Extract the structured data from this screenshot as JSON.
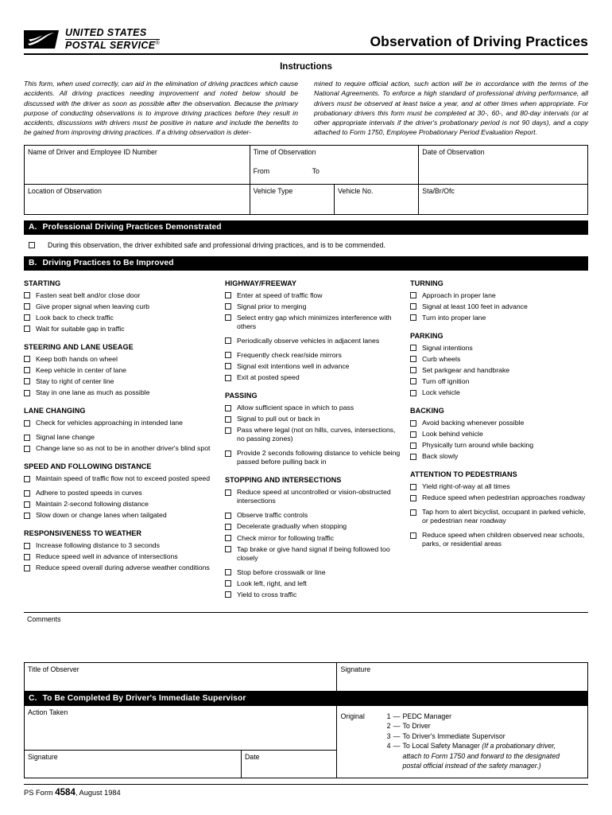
{
  "header": {
    "logo_line1": "UNITED STATES",
    "logo_line2": "POSTAL SERVICE",
    "logo_mark": "registered-mark",
    "title": "Observation of Driving Practices"
  },
  "instructions": {
    "heading": "Instructions",
    "paragraph_left": "This form, when used correctly, can aid in the elimination of driving practices which cause accidents. All driving practices needing improvement and noted below should be discussed with the driver as soon as possible after the observation. Because the primary purpose of conducting observations is to improve driving practices before they result in accidents, discussions with drivers must be positive in nature and include the benefits to be gained from improving driving practices. If a driving observation is deter-",
    "paragraph_right": "mined to require official action, such action will be in accordance with the terms of the National Agreements. To enforce a high standard of professional driving performance, all drivers must be observed at least twice a year, and at other times when appropriate. For probationary drivers this form must be completed at 30-, 60-, and 80-day intervals (or at other appropriate intervals if the driver's probationary period is not 90 days), and a copy attached to Form 1750, Employee Probationary Period Evaluation Report."
  },
  "fields": {
    "name_of_driver": "Name of Driver and Employee ID Number",
    "time_of_observation": "Time of Observation",
    "from": "From",
    "to": "To",
    "date_of_observation": "Date of Observation",
    "location_of_observation": "Location of Observation",
    "vehicle_type": "Vehicle Type",
    "vehicle_no": "Vehicle No.",
    "sta_br_ofc": "Sta/Br/Ofc"
  },
  "section_a": {
    "letter": "A.",
    "title": "Professional Driving Practices Demonstrated",
    "checkbox_label": "During this observation, the driver exhibited safe and professional driving practices, and is to be commended."
  },
  "section_b": {
    "letter": "B.",
    "title": "Driving Practices to Be Improved",
    "columns": [
      {
        "groups": [
          {
            "title": "STARTING",
            "items": [
              {
                "text": "Fasten seat belt and/or close door",
                "gap": false
              },
              {
                "text": "Give proper signal when leaving curb",
                "gap": false
              },
              {
                "text": "Look back to check traffic",
                "gap": false
              },
              {
                "text": "Wait for suitable gap in traffic",
                "gap": false
              }
            ]
          },
          {
            "title": "STEERING AND LANE USEAGE",
            "items": [
              {
                "text": "Keep both hands on wheel",
                "gap": false
              },
              {
                "text": "Keep vehicle in center of lane",
                "gap": false
              },
              {
                "text": "Stay to right of center line",
                "gap": false
              },
              {
                "text": "Stay in one lane as much as possible",
                "gap": false
              }
            ]
          },
          {
            "title": "LANE CHANGING",
            "items": [
              {
                "text": "Check for vehicles approaching in intended lane",
                "gap": false
              },
              {
                "text": "Signal lane change",
                "gap": true
              },
              {
                "text": "Change lane so as not to be in another driver's blind spot",
                "gap": false
              }
            ]
          },
          {
            "title": "SPEED AND FOLLOWING DISTANCE",
            "items": [
              {
                "text": "Maintain speed of traffic flow not to exceed posted speed",
                "gap": false
              },
              {
                "text": "Adhere to posted speeds in curves",
                "gap": true
              },
              {
                "text": "Maintain 2-second following distance",
                "gap": false
              },
              {
                "text": "Slow down or change lanes when tailgated",
                "gap": false
              }
            ]
          },
          {
            "title": "RESPONSIVENESS TO WEATHER",
            "items": [
              {
                "text": "Increase following distance to 3 seconds",
                "gap": false
              },
              {
                "text": "Reduce speed well in advance of intersections",
                "gap": false
              },
              {
                "text": "Reduce speed overall during adverse weather conditions",
                "gap": false
              }
            ]
          }
        ]
      },
      {
        "groups": [
          {
            "title": "HIGHWAY/FREEWAY",
            "items": [
              {
                "text": "Enter at speed of traffic flow",
                "gap": false
              },
              {
                "text": "Signal prior to merging",
                "gap": false
              },
              {
                "text": "Select entry gap which minimizes interference with others",
                "gap": false
              },
              {
                "text": "Periodically observe vehicles in adjacent lanes",
                "gap": true
              },
              {
                "text": "Frequently check rear/side mirrors",
                "gap": true
              },
              {
                "text": "Signal exit intentions well in advance",
                "gap": false
              },
              {
                "text": "Exit at posted speed",
                "gap": false
              }
            ]
          },
          {
            "title": "PASSING",
            "items": [
              {
                "text": "Allow sufficient space in which to pass",
                "gap": false
              },
              {
                "text": "Signal to pull out or back in",
                "gap": false
              },
              {
                "text": "Pass where legal (not on hills, curves, intersections, no passing zones)",
                "gap": false
              },
              {
                "text": "Provide 2 seconds following distance to vehicle being passed before pulling back in",
                "gap": true
              }
            ]
          },
          {
            "title": "STOPPING AND INTERSECTIONS",
            "items": [
              {
                "text": "Reduce speed at uncontrolled or vision-obstructed intersections",
                "gap": false
              },
              {
                "text": "Observe traffic controls",
                "gap": true
              },
              {
                "text": "Decelerate gradually when stopping",
                "gap": false
              },
              {
                "text": "Check mirror for following traffic",
                "gap": false
              },
              {
                "text": "Tap brake or give hand signal if being followed too closely",
                "gap": false
              },
              {
                "text": "Stop before crosswalk or line",
                "gap": true
              },
              {
                "text": "Look left, right, and left",
                "gap": false
              },
              {
                "text": "Yield to cross traffic",
                "gap": false
              }
            ]
          }
        ]
      },
      {
        "groups": [
          {
            "title": "TURNING",
            "items": [
              {
                "text": "Approach in proper lane",
                "gap": false
              },
              {
                "text": "Signal at least 100 feet in advance",
                "gap": false
              },
              {
                "text": "Turn into proper lane",
                "gap": false
              }
            ]
          },
          {
            "title": "PARKING",
            "items": [
              {
                "text": "Signal intentions",
                "gap": false
              },
              {
                "text": "Curb wheels",
                "gap": false
              },
              {
                "text": "Set parkgear and handbrake",
                "gap": false
              },
              {
                "text": "Turn off ignition",
                "gap": false
              },
              {
                "text": "Lock vehicle",
                "gap": false
              }
            ]
          },
          {
            "title": "BACKING",
            "items": [
              {
                "text": "Avoid backing whenever possible",
                "gap": false
              },
              {
                "text": "Look behind vehicle",
                "gap": false
              },
              {
                "text": "Physically turn around while backing",
                "gap": false
              },
              {
                "text": "Back slowly",
                "gap": false
              }
            ]
          },
          {
            "title": "ATTENTION TO PEDESTRIANS",
            "items": [
              {
                "text": "Yield right-of-way at all times",
                "gap": false
              },
              {
                "text": "Reduce speed when pedestrian approaches roadway",
                "gap": false
              },
              {
                "text": "Tap horn to alert bicyclist, occupant in parked vehicle, or pedestrian near roadway",
                "gap": true
              },
              {
                "text": "Reduce speed when children observed near schools, parks, or residential areas",
                "gap": true
              }
            ]
          }
        ]
      }
    ]
  },
  "comments": {
    "label": "Comments"
  },
  "observer": {
    "title_label": "Title of Observer",
    "signature_label": "Signature"
  },
  "section_c": {
    "letter": "C.",
    "title": "To Be Completed By Driver's Immediate Supervisor",
    "action_taken_label": "Action Taken",
    "signature_label": "Signature",
    "date_label": "Date",
    "original_label": "Original",
    "copies": [
      {
        "num": "1",
        "dash": "—",
        "text": "PEDC Manager"
      },
      {
        "num": "2",
        "dash": "—",
        "text": "To Driver"
      },
      {
        "num": "3",
        "dash": "—",
        "text": "To Driver's Immediate Supervisor"
      },
      {
        "num": "4",
        "dash": "—",
        "text": "To Local Safety Manager "
      }
    ],
    "copy4_italic": "(If a probationary driver,",
    "copy4_italic_line2": "attach to Form 1750 and forward to the designated",
    "copy4_italic_line3": "postal official instead of the safety manager.)"
  },
  "footer": {
    "prefix": "PS Form ",
    "number": "4584",
    "suffix": ", August 1984"
  }
}
